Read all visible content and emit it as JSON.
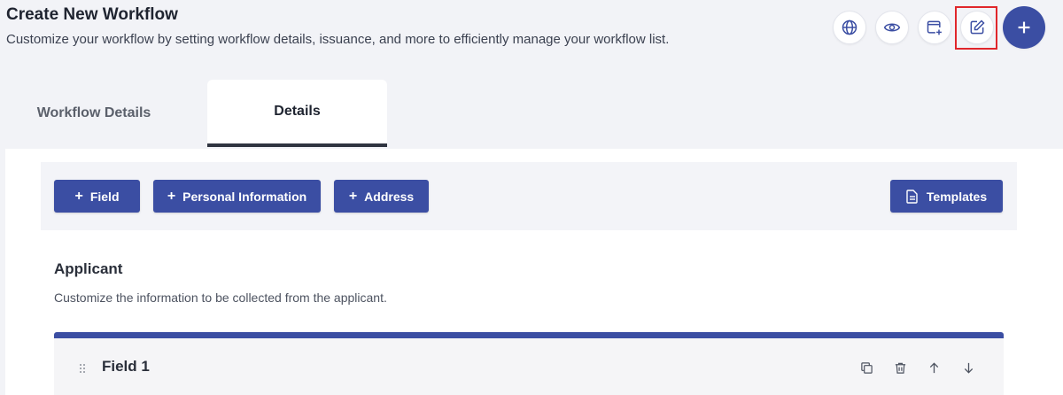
{
  "header": {
    "title": "Create New Workflow",
    "subtitle": "Customize your workflow by setting workflow details, issuance, and more to efficiently manage your workflow list."
  },
  "header_actions": {
    "icons": [
      "globe-icon",
      "eye-icon",
      "new-window-icon",
      "edit-icon",
      "plus-icon"
    ],
    "highlighted": "edit-icon"
  },
  "tabs": [
    {
      "label": "Workflow Details",
      "active": false
    },
    {
      "label": "Details",
      "active": true
    }
  ],
  "toolbar": {
    "buttons": [
      {
        "label": "Field",
        "icon": "plus-icon"
      },
      {
        "label": "Personal Information",
        "icon": "plus-icon"
      },
      {
        "label": "Address",
        "icon": "plus-icon"
      }
    ],
    "templates_label": "Templates",
    "templates_icon": "document-icon"
  },
  "section": {
    "title": "Applicant",
    "description": "Customize the information to be collected from the applicant."
  },
  "fields": [
    {
      "name": "Field 1",
      "actions": [
        "copy-icon",
        "trash-icon",
        "arrow-up-icon",
        "arrow-down-icon"
      ]
    }
  ],
  "colors": {
    "primary": "#3b4ea3",
    "highlight": "#e0262b",
    "page_background": "#f2f3f7"
  }
}
